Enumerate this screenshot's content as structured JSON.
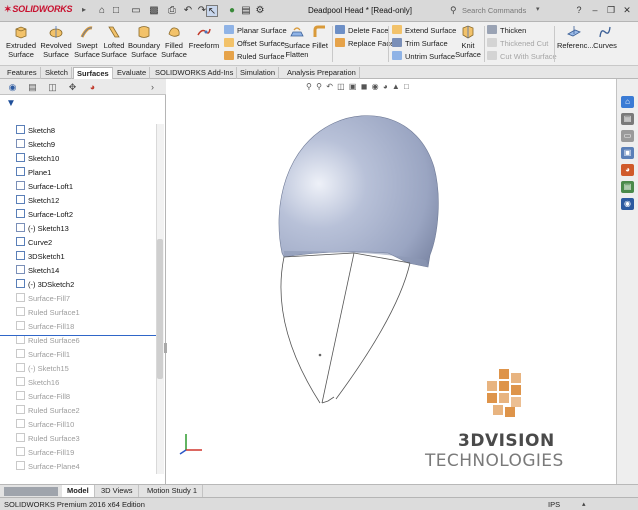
{
  "app": {
    "brand": "SOLIDWORKS",
    "document_title": "Deadpool Head * [Read-only]",
    "search_placeholder": "Search Commands"
  },
  "ribbon": {
    "big_commands": [
      {
        "id": "extruded-surface",
        "label_lines": [
          "Extruded",
          "Surface"
        ],
        "icon": "extrude-surface-icon"
      },
      {
        "id": "revolved-surface",
        "label_lines": [
          "Revolved",
          "Surface"
        ],
        "icon": "revolve-surface-icon"
      },
      {
        "id": "swept-surface",
        "label_lines": [
          "Swept",
          "Surface"
        ],
        "icon": "sweep-surface-icon"
      },
      {
        "id": "lofted-surface",
        "label_lines": [
          "Lofted",
          "Surface"
        ],
        "icon": "loft-surface-icon"
      },
      {
        "id": "boundary-surface",
        "label_lines": [
          "Boundary",
          "Surface"
        ],
        "icon": "boundary-surface-icon"
      },
      {
        "id": "filled-surface",
        "label_lines": [
          "Filled",
          "Surface"
        ],
        "icon": "filled-surface-icon"
      },
      {
        "id": "freeform",
        "label_lines": [
          "Freeform",
          ""
        ],
        "icon": "freeform-icon"
      }
    ],
    "col1": [
      "Planar Surface",
      "Offset Surface",
      "Ruled Surface"
    ],
    "mid_commands": [
      {
        "id": "surface-flatten",
        "label_lines": [
          "Surface",
          "Flatten"
        ]
      },
      {
        "id": "fillet",
        "label_lines": [
          "Fillet",
          ""
        ]
      }
    ],
    "col2": [
      "Delete Face",
      "Replace Face"
    ],
    "col3": [
      "Extend Surface",
      "Trim Surface",
      "Untrim Surface"
    ],
    "knit": {
      "label_lines": [
        "Knit",
        "Surface"
      ]
    },
    "col4": [
      "Thicken",
      "Thickened Cut",
      "Cut With Surface"
    ],
    "right_commands": [
      {
        "id": "reference-geometry",
        "label": "Referenc..."
      },
      {
        "id": "curves",
        "label": "Curves"
      }
    ]
  },
  "command_tabs": [
    "Features",
    "Sketch",
    "Surfaces",
    "Evaluate",
    "SOLIDWORKS Add-Ins",
    "Simulation",
    "Analysis Preparation"
  ],
  "active_command_tab": "Surfaces",
  "feature_tree": {
    "items": [
      {
        "label": "Sketch8",
        "suppressed": false
      },
      {
        "label": "Sketch9",
        "suppressed": false
      },
      {
        "label": "Sketch10",
        "suppressed": false
      },
      {
        "label": "Plane1",
        "suppressed": false
      },
      {
        "label": "Surface-Loft1",
        "suppressed": false
      },
      {
        "label": "Sketch12",
        "suppressed": false
      },
      {
        "label": "Surface-Loft2",
        "suppressed": false
      },
      {
        "label": "(-) Sketch13",
        "suppressed": false
      },
      {
        "label": "Curve2",
        "suppressed": false
      },
      {
        "label": "3DSketch1",
        "suppressed": false
      },
      {
        "label": "Sketch14",
        "suppressed": false
      },
      {
        "label": "(-) 3DSketch2",
        "suppressed": false
      },
      {
        "label": "Surface-Fill7",
        "suppressed": true
      },
      {
        "label": "Ruled Surface1",
        "suppressed": true
      },
      {
        "label": "Surface-Fill18",
        "suppressed": true
      },
      {
        "label": "Ruled Surface6",
        "suppressed": true
      },
      {
        "label": "Surface-Fill1",
        "suppressed": true
      },
      {
        "label": "(-) Sketch15",
        "suppressed": true
      },
      {
        "label": "Sketch16",
        "suppressed": true
      },
      {
        "label": "Surface-Fill8",
        "suppressed": true
      },
      {
        "label": "Ruled Surface2",
        "suppressed": true
      },
      {
        "label": "Surface-Fill10",
        "suppressed": true
      },
      {
        "label": "Ruled Surface3",
        "suppressed": true
      },
      {
        "label": "Surface-Fill19",
        "suppressed": true
      },
      {
        "label": "Surface-Plane4",
        "suppressed": true
      }
    ]
  },
  "watermark": {
    "line1_bold": "3DVISION",
    "line2": "TECHNOLOGIES"
  },
  "bottom_tabs": [
    "Model",
    "3D Views",
    "Motion Study 1"
  ],
  "active_bottom_tab": "Model",
  "status": {
    "text": "SOLIDWORKS Premium 2016 x64 Edition",
    "units": "IPS"
  },
  "colors": {
    "model_surface": "#a3aec9",
    "rollback_bar": "#2f66c8",
    "brand_red": "#c8102e",
    "watermark_orange": "#d9822b"
  }
}
